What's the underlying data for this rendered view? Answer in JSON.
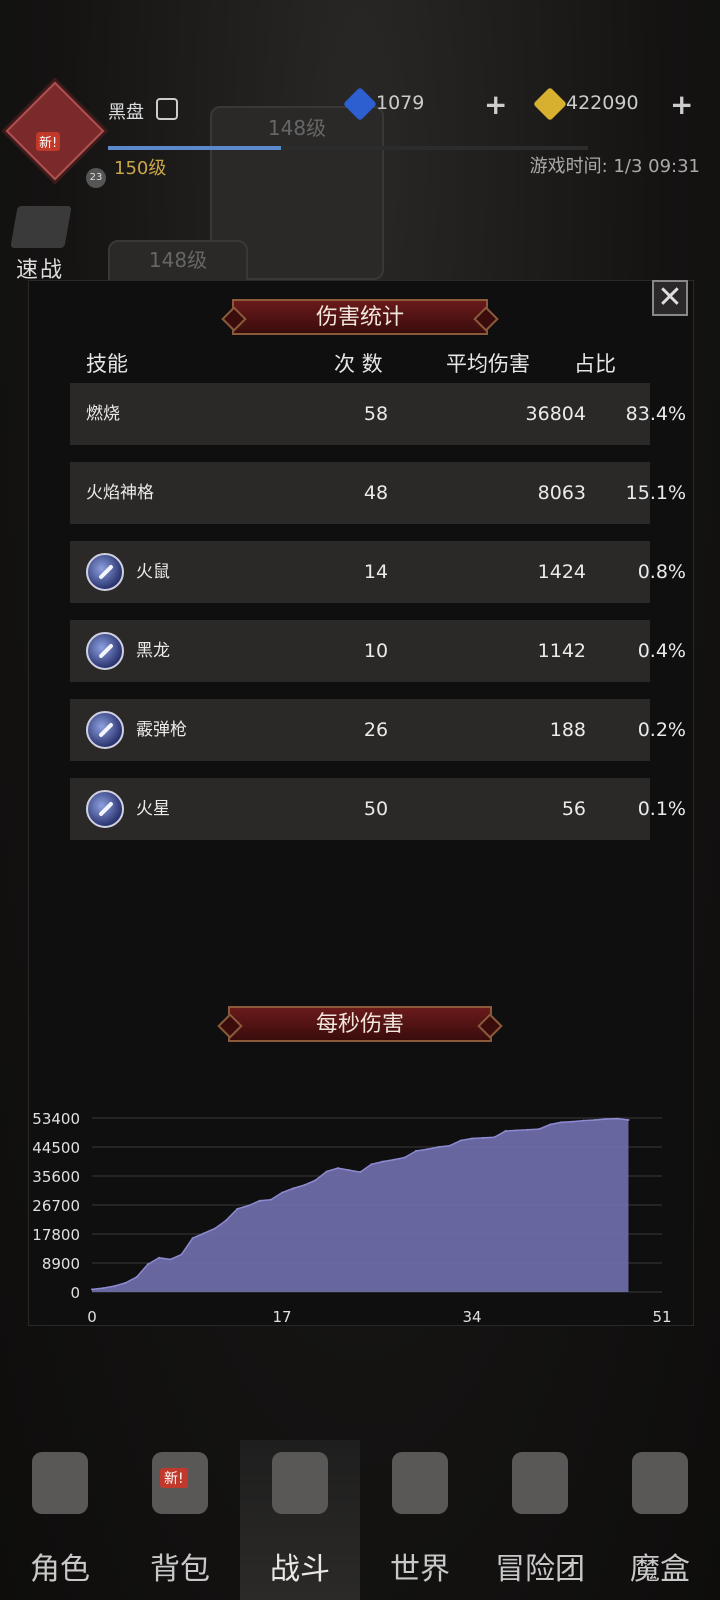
{
  "header": {
    "player_name": "黑盘",
    "player_level": "150级",
    "avatar_badge": "新!",
    "small_level": "23",
    "gems": "1079",
    "gold": "422090",
    "game_time": "游戏时间: 1/3 09:31",
    "quick_battle_label": "速战",
    "ghost_level_1": "148级",
    "ghost_level_2": "148级"
  },
  "damage_stats": {
    "title": "伤害统计",
    "columns": {
      "skill": "技能",
      "count": "次 数",
      "avg": "平均伤害",
      "pct": "占比"
    },
    "rows": [
      {
        "name": "燃烧",
        "count": "58",
        "avg": "36804",
        "pct": "83.4%",
        "icon": ""
      },
      {
        "name": "火焰神格",
        "count": "48",
        "avg": "8063",
        "pct": "15.1%",
        "icon": ""
      },
      {
        "name": "火鼠",
        "count": "14",
        "avg": "1424",
        "pct": "0.8%",
        "icon": "fire-rat-skill-icon"
      },
      {
        "name": "黑龙",
        "count": "10",
        "avg": "1142",
        "pct": "0.4%",
        "icon": "black-dragon-skill-icon"
      },
      {
        "name": "霰弹枪",
        "count": "26",
        "avg": "188",
        "pct": "0.2%",
        "icon": "shotgun-skill-icon"
      },
      {
        "name": "火星",
        "count": "50",
        "avg": "56",
        "pct": "0.1%",
        "icon": "spark-skill-icon"
      }
    ]
  },
  "dps": {
    "title": "每秒伤害"
  },
  "chart_data": {
    "type": "area",
    "title": "每秒伤害",
    "xlabel": "",
    "ylabel": "",
    "x_ticks": [
      0,
      17,
      34,
      51
    ],
    "y_ticks": [
      0,
      8900,
      17800,
      26700,
      35600,
      44500,
      53400
    ],
    "xlim": [
      0,
      51
    ],
    "ylim": [
      0,
      53400
    ],
    "grid": true,
    "x": [
      0,
      1,
      2,
      3,
      4,
      5,
      6,
      7,
      8,
      9,
      10,
      11,
      12,
      13,
      14,
      15,
      16,
      17,
      18,
      19,
      20,
      21,
      22,
      23,
      24,
      25,
      26,
      27,
      28,
      29,
      30,
      31,
      32,
      33,
      34,
      35,
      36,
      37,
      38,
      39,
      40,
      41,
      42,
      43,
      44,
      45,
      46,
      47,
      48
    ],
    "values": [
      800,
      1200,
      1800,
      2800,
      4600,
      8500,
      10500,
      10000,
      11500,
      16500,
      18000,
      19500,
      22000,
      25500,
      26500,
      28000,
      28300,
      30500,
      31800,
      32800,
      34300,
      37000,
      38000,
      37400,
      36800,
      39200,
      40000,
      40600,
      41300,
      43300,
      43800,
      44500,
      44900,
      46500,
      47100,
      47300,
      47500,
      49400,
      49600,
      49800,
      50000,
      51400,
      52100,
      52300,
      52600,
      52800,
      53100,
      53200,
      52800
    ],
    "colors": {
      "fill": "#6e6ca8",
      "stroke": "#8c8ad0"
    }
  },
  "nav": {
    "items": [
      {
        "label": "角色",
        "icon": "helmet-icon",
        "badge": ""
      },
      {
        "label": "背包",
        "icon": "backpack-icon",
        "badge": "新!"
      },
      {
        "label": "战斗",
        "icon": "sword-shield-icon",
        "badge": ""
      },
      {
        "label": "世界",
        "icon": "map-scroll-icon",
        "badge": ""
      },
      {
        "label": "冒险团",
        "icon": "castle-icon",
        "badge": ""
      },
      {
        "label": "魔盒",
        "icon": "magic-box-icon",
        "badge": ""
      }
    ]
  },
  "close_symbol": "✕"
}
